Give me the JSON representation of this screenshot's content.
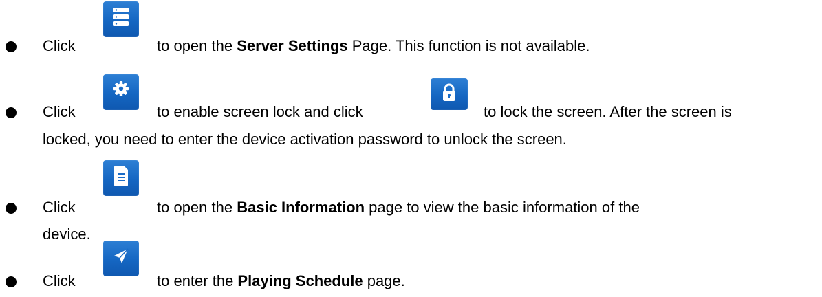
{
  "items": [
    {
      "click": "Click",
      "icon": "server-settings-icon",
      "before": "to open the ",
      "bold": "Server Settings",
      "after": " Page. This function is not available."
    },
    {
      "click": "Click",
      "icon": "gear-icon",
      "middle": "to enable screen lock and click",
      "icon2": "lock-icon",
      "after": "to lock the screen. After the screen is",
      "continuation": "locked, you need to enter the device activation password to unlock the screen."
    },
    {
      "click": "Click",
      "icon": "document-icon",
      "before": "to open the ",
      "bold": "Basic Information",
      "after": " page to view the basic information of the",
      "continuation": "device."
    },
    {
      "click": "Click",
      "icon": "send-icon",
      "before": "to enter the ",
      "bold": "Playing Schedule",
      "after": " page."
    }
  ],
  "colors": {
    "icon_blue": "#1a6cc8",
    "text": "#000000"
  }
}
